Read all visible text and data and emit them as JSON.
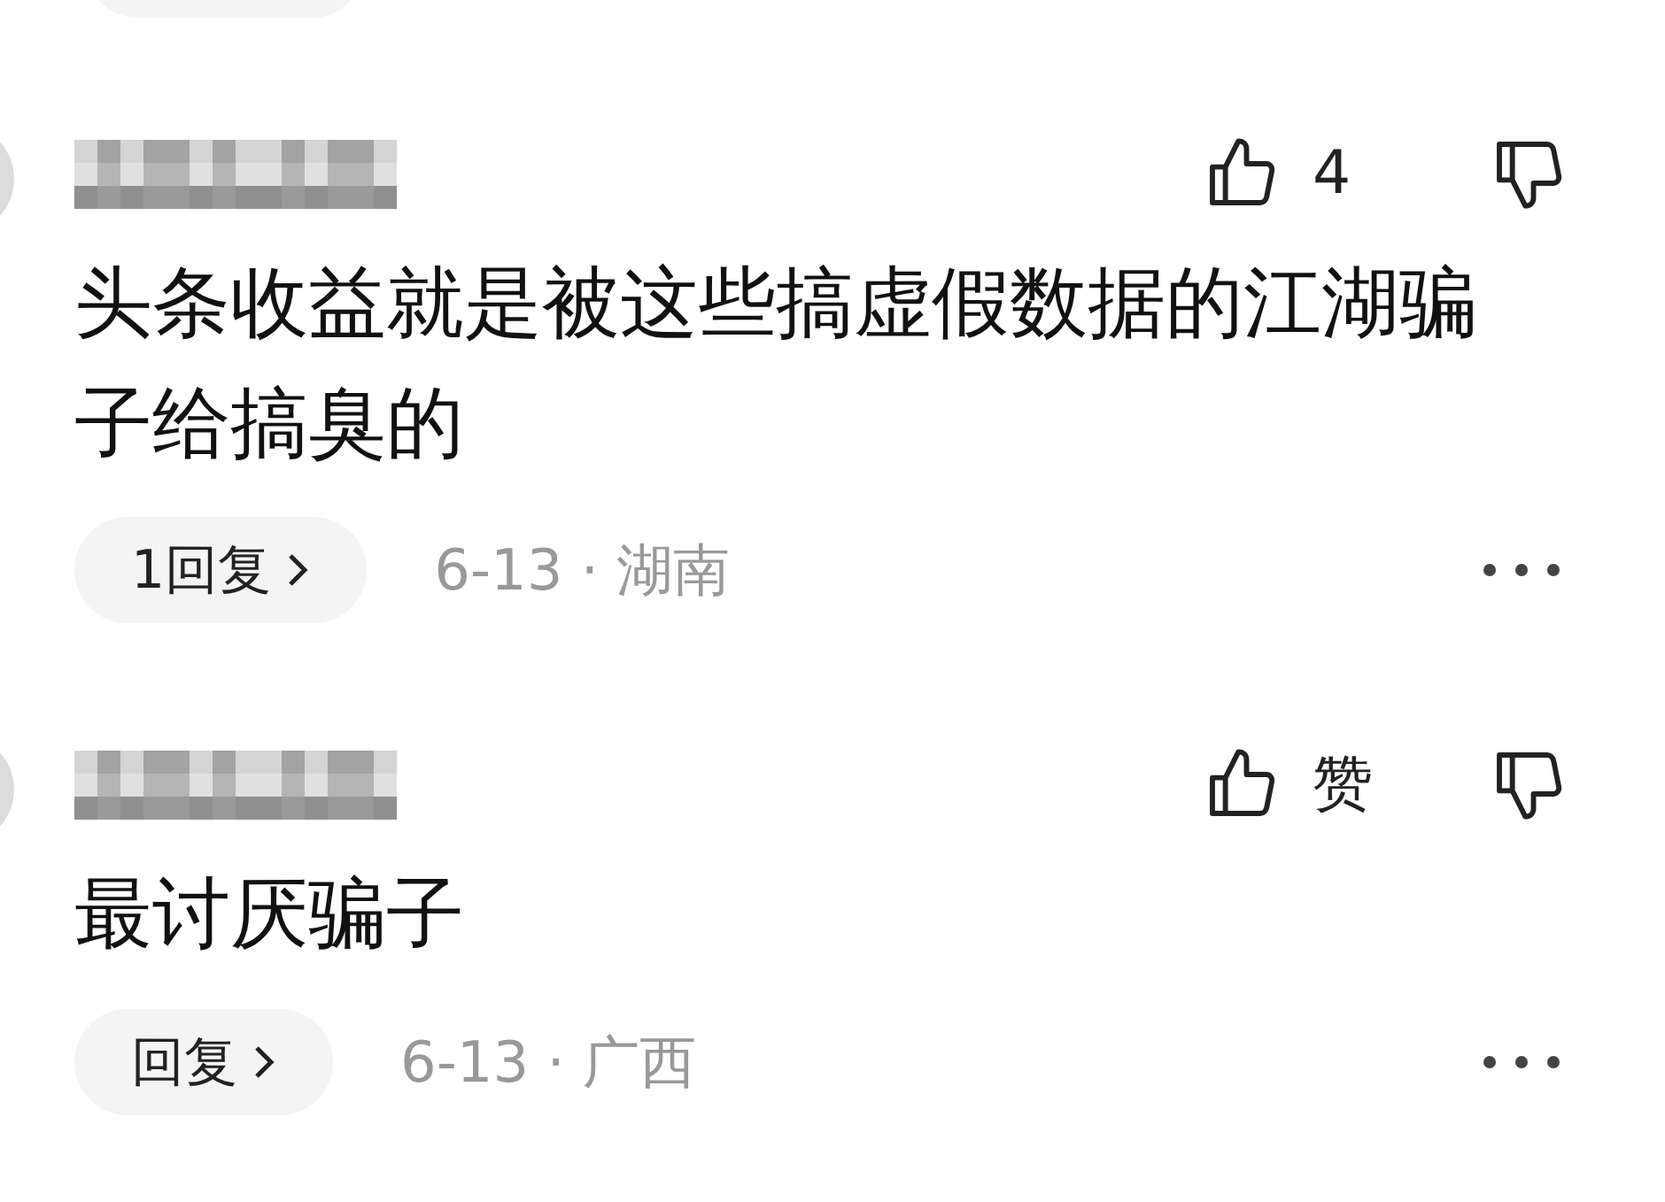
{
  "comments": [
    {
      "like_label": "4",
      "text": "头条收益就是被这些搞虚假数据的江湖骗子给搞臭的",
      "reply_label": "1回复",
      "meta": "6-13 · 湖南"
    },
    {
      "like_label": "赞",
      "text": "最讨厌骗子",
      "reply_label": "回复",
      "meta": "6-13 · 广西"
    }
  ]
}
